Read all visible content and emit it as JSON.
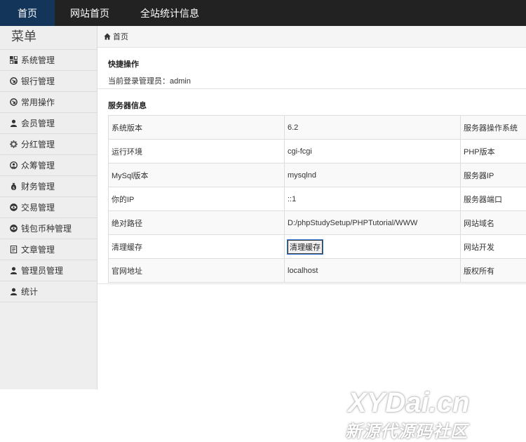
{
  "topnav": {
    "items": [
      {
        "label": "首页"
      },
      {
        "label": "网站首页"
      },
      {
        "label": "全站统计信息"
      }
    ]
  },
  "sidebar": {
    "title": "菜单",
    "items": [
      {
        "label": "系统管理",
        "icon": "grid-icon"
      },
      {
        "label": "银行管理",
        "icon": "circle-arrow-icon"
      },
      {
        "label": "常用操作",
        "icon": "circle-arrow-icon"
      },
      {
        "label": "会员管理",
        "icon": "user-icon"
      },
      {
        "label": "分红管理",
        "icon": "gear-icon"
      },
      {
        "label": "众筹管理",
        "icon": "user-circle-icon"
      },
      {
        "label": "财务管理",
        "icon": "money-bag-icon"
      },
      {
        "label": "交易管理",
        "icon": "eye-icon"
      },
      {
        "label": "钱包币种管理",
        "icon": "eye-icon"
      },
      {
        "label": "文章管理",
        "icon": "document-icon"
      },
      {
        "label": "管理员管理",
        "icon": "user-icon"
      },
      {
        "label": "统计",
        "icon": "user-icon"
      }
    ]
  },
  "breadcrumb": {
    "label": "首页"
  },
  "quick_ops": {
    "title": "快捷操作",
    "admin_line": "当前登录管理员：admin"
  },
  "server_info": {
    "title": "服务器信息",
    "rows": [
      {
        "label": "系统版本",
        "value": "6.2",
        "extra": "服务器操作系统"
      },
      {
        "label": "运行环境",
        "value": "cgi-fcgi",
        "extra": "PHP版本"
      },
      {
        "label": "MySql版本",
        "value": "mysqlnd",
        "extra": "服务器IP"
      },
      {
        "label": "你的IP",
        "value": "::1",
        "extra": "服务器端口"
      },
      {
        "label": "绝对路径",
        "value": "D:/phpStudySetup/PHPTutorial/WWW",
        "extra": "网站域名"
      },
      {
        "label": "清理缓存",
        "value": "清理缓存",
        "extra": "网站开发"
      },
      {
        "label": "官网地址",
        "value": "localhost",
        "extra": "版权所有"
      }
    ]
  },
  "watermark": {
    "line1": "XYDai.cn",
    "line2": "新源代源码社区"
  },
  "colors": {
    "topbar": "#222222",
    "active_nav": "#13355a",
    "sidebar": "#eeeeee"
  }
}
